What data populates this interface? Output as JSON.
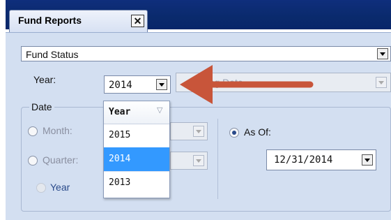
{
  "tab": {
    "title": "Fund Reports",
    "close_glyph": "✕"
  },
  "report_select": {
    "value": "Fund Status"
  },
  "year": {
    "label": "Year:",
    "value": "2014"
  },
  "reporting_date": {
    "partial_text": "...ting Date"
  },
  "date_group": {
    "legend": "Date",
    "month_label": "Month:",
    "quarter_label": "Quarter:",
    "year_label": "Year",
    "as_of_label": "As Of:",
    "as_of_value": "12/31/2014",
    "selected": "As Of"
  },
  "year_dropdown": {
    "header": "Year",
    "sort_glyph": "▽",
    "options": [
      "2015",
      "2014",
      "2013"
    ],
    "selected": "2014"
  },
  "annotation": {
    "arrow_color": "#c8553a"
  },
  "colors": {
    "topbar": "#0a2a6c",
    "panel": "#d3dff1",
    "selection": "#3399ff"
  }
}
